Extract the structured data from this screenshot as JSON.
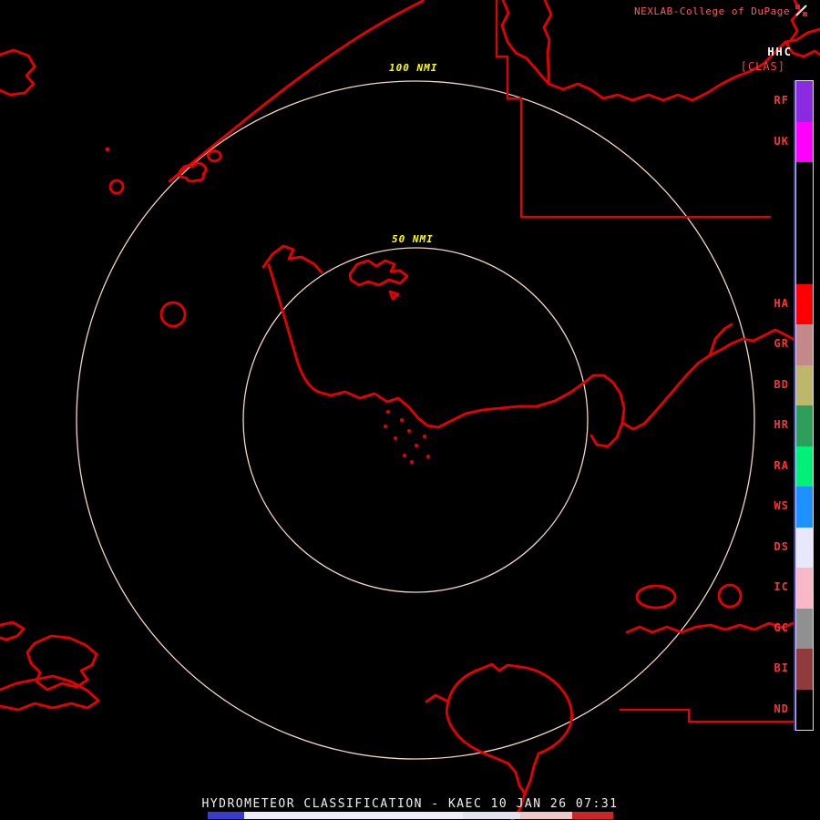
{
  "header": {
    "brand": "NEXLAB-College of DuPage",
    "product_code": "HHC",
    "product_mode": "[CLAS]"
  },
  "map": {
    "outer_range_label": "100 NMI",
    "inner_range_label": "50 NMI",
    "range_ring_color": "#F6D7C3",
    "boundary_color": "#E80000"
  },
  "legend": {
    "rows": [
      {
        "label": "RF",
        "color": "#8A2BE2"
      },
      {
        "label": "UK",
        "color": "#FF00FF"
      },
      {
        "label": "",
        "color": "#000000"
      },
      {
        "label": "",
        "color": "#000000"
      },
      {
        "label": "",
        "color": "#000000"
      },
      {
        "label": "HA",
        "color": "#FF0000"
      },
      {
        "label": "GR",
        "color": "#C38888"
      },
      {
        "label": "BD",
        "color": "#BDB76B"
      },
      {
        "label": "HR",
        "color": "#2E9E5B"
      },
      {
        "label": "RA",
        "color": "#00F078"
      },
      {
        "label": "WS",
        "color": "#1E90FF"
      },
      {
        "label": "DS",
        "color": "#E8E8FA"
      },
      {
        "label": "IC",
        "color": "#F8B8C8"
      },
      {
        "label": "GC",
        "color": "#909090"
      },
      {
        "label": "BI",
        "color": "#8F3B3B"
      },
      {
        "label": "ND",
        "color": "#000000"
      }
    ]
  },
  "footer": {
    "title": "HYDROMETEOR CLASSIFICATION - KAEC 10 JAN 26 07:31",
    "colorbar": [
      "#3A3ACC",
      "#EEEEF8",
      "#E3E3F0",
      "#EFC9C9",
      "#CC2525"
    ]
  }
}
